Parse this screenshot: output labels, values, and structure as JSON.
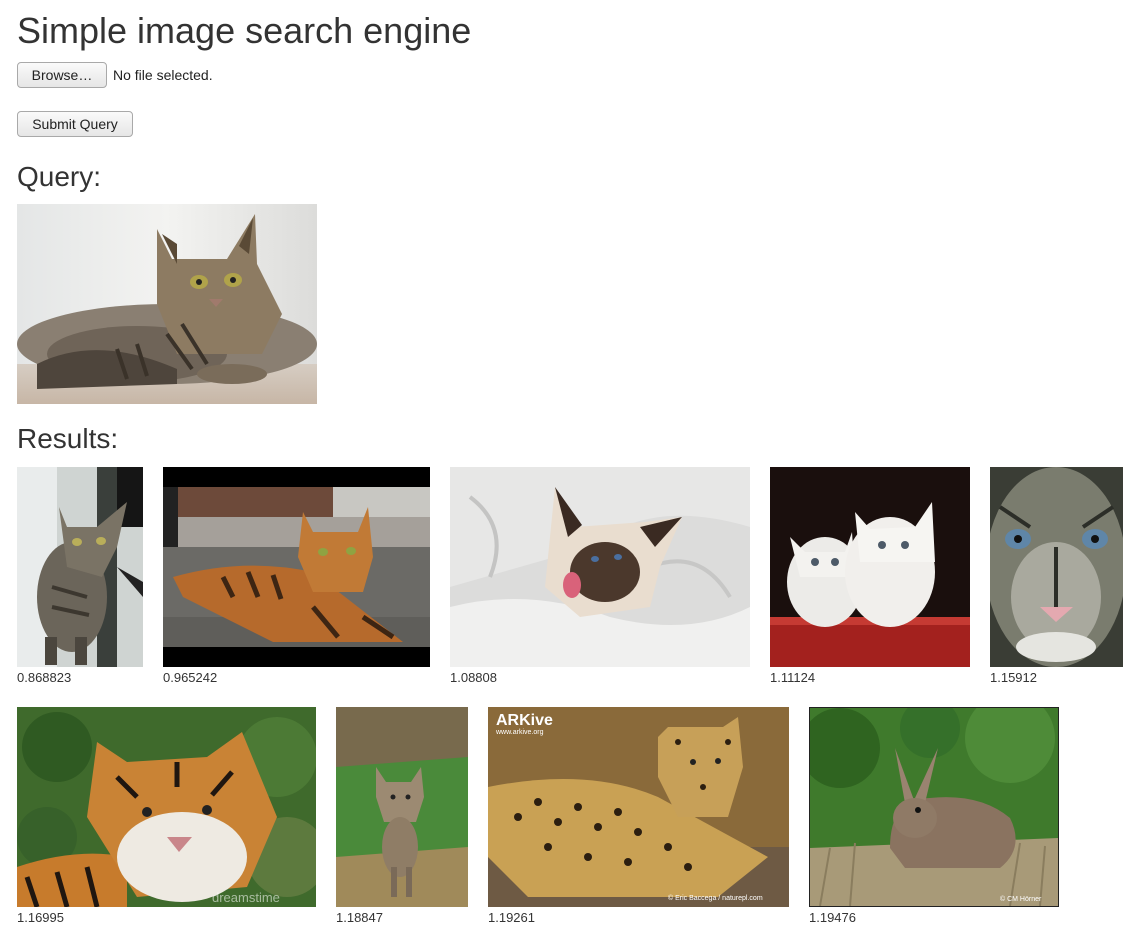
{
  "page": {
    "title": "Simple image search engine"
  },
  "upload": {
    "browse_label": "Browse…",
    "file_status": "No file selected.",
    "submit_label": "Submit Query"
  },
  "query": {
    "heading": "Query:",
    "image": {
      "subject": "tabby cat lying on floor"
    }
  },
  "results": {
    "heading": "Results:",
    "items": [
      {
        "subject": "tabby cat standing by post",
        "score": "0.868823"
      },
      {
        "subject": "bengal cat lying on steps",
        "score": "0.965242"
      },
      {
        "subject": "siamese cat on white sheets",
        "score": "1.08808"
      },
      {
        "subject": "two white persian kittens",
        "score": "1.11124"
      },
      {
        "subject": "cougar face close-up",
        "score": "1.15912"
      },
      {
        "subject": "tiger lying in grass",
        "score": "1.16995",
        "watermark": "dreamstime"
      },
      {
        "subject": "coyote standing in grass",
        "score": "1.18847"
      },
      {
        "subject": "leopard lying on rock",
        "score": "1.19261",
        "watermark": "ARKive",
        "watermark_url": "www.arkive.org",
        "credit": "© Eric Baccega / naturepl.com"
      },
      {
        "subject": "wild rabbit in grass",
        "score": "1.19476",
        "credit": "© CM Hörner"
      }
    ]
  }
}
